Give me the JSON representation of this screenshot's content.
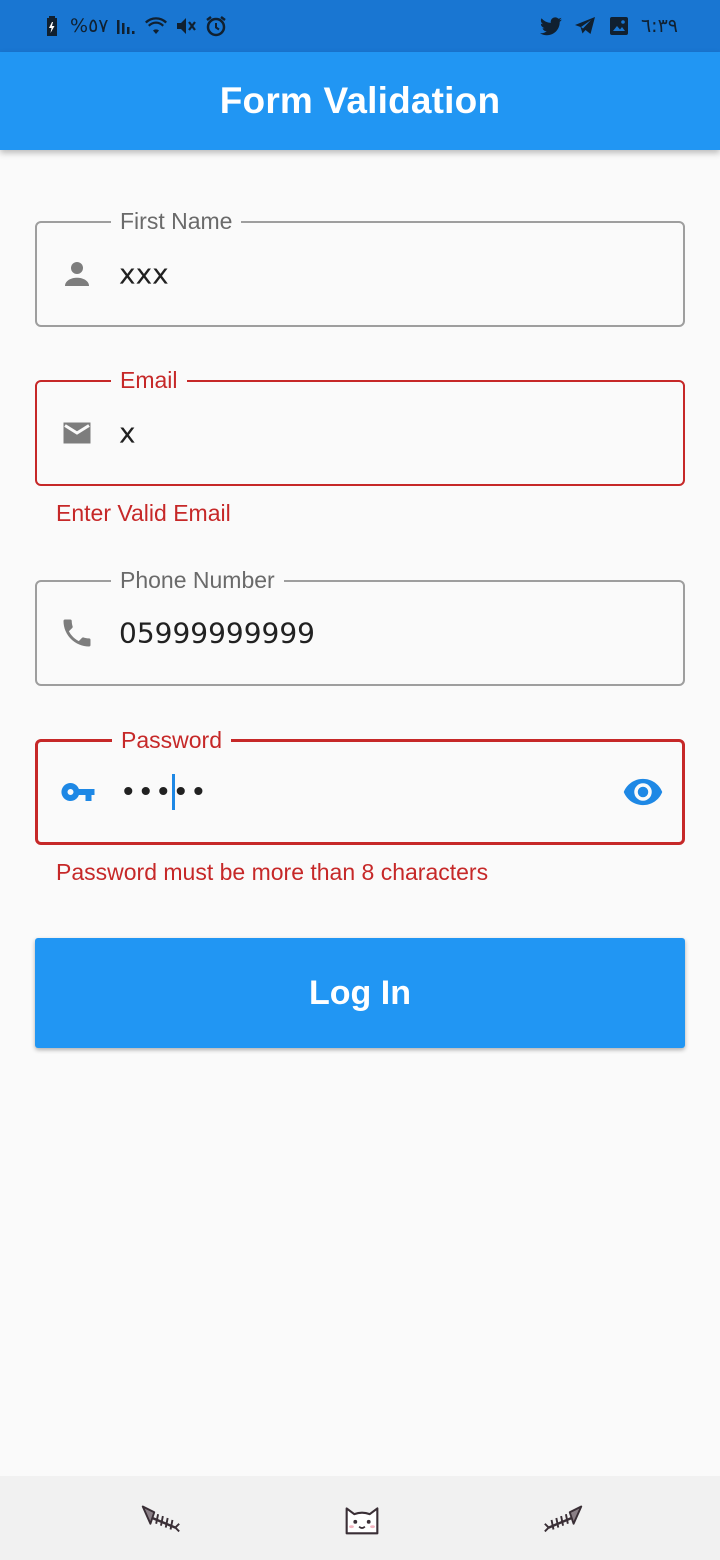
{
  "status_bar": {
    "battery_text": "%٥٧",
    "time": "٦:٣٩",
    "left_icons": [
      "battery-icon",
      "signal-icon",
      "wifi-icon",
      "mute-icon",
      "alarm-icon"
    ],
    "right_icons": [
      "twitter-icon",
      "telegram-icon",
      "gallery-icon"
    ]
  },
  "app_bar": {
    "title": "Form Validation"
  },
  "form": {
    "first_name": {
      "label": "First Name",
      "value": "xxx",
      "icon": "person-icon"
    },
    "email": {
      "label": "Email",
      "value": "x",
      "error": "Enter Valid Email",
      "icon": "email-icon"
    },
    "phone": {
      "label": "Phone Number",
      "value": "05999999999",
      "icon": "phone-icon"
    },
    "password": {
      "label": "Password",
      "value": "•••••",
      "error": "Password must be more than 8 characters",
      "icon": "key-icon",
      "trailing_icon": "eye-icon"
    }
  },
  "login_button": {
    "label": "Log In"
  },
  "nav_bar": {
    "icons": [
      "fishbone-left-icon",
      "cat-face-icon",
      "fishbone-right-icon"
    ]
  },
  "colors": {
    "status_bar": "#1976d2",
    "primary": "#2196f3",
    "error": "#c62828",
    "outline": "#9e9e9e",
    "background": "#fafafa"
  }
}
